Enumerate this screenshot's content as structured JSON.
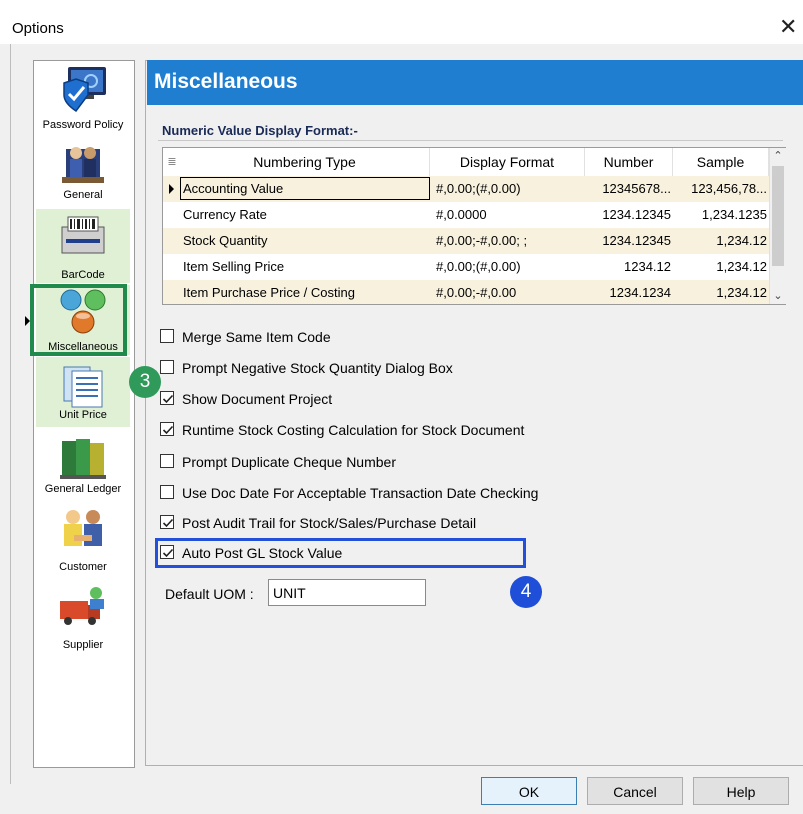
{
  "window": {
    "title": "Options",
    "close_glyph": "✕"
  },
  "sidebar": {
    "items": [
      {
        "label": "Password Policy",
        "icon": "monitor-shield-icon"
      },
      {
        "label": "General",
        "icon": "people-office-icon"
      },
      {
        "label": "BarCode",
        "icon": "barcode-printer-icon"
      },
      {
        "label": "Miscellaneous",
        "icon": "color-balls-icon"
      },
      {
        "label": "Unit Price",
        "icon": "price-sheets-icon"
      },
      {
        "label": "General Ledger",
        "icon": "ledger-books-icon"
      },
      {
        "label": "Customer",
        "icon": "customer-handshake-icon"
      },
      {
        "label": "Supplier",
        "icon": "supplier-truck-icon"
      }
    ],
    "selected": "Miscellaneous"
  },
  "badges": {
    "step3": "3",
    "step4": "4"
  },
  "panel": {
    "title": "Miscellaneous",
    "group_title": "Numeric Value Display Format:-",
    "grid": {
      "grip": "≣",
      "columns": [
        "Numbering Type",
        "Display Format",
        "Number",
        "Sample"
      ],
      "rows": [
        [
          "Accounting Value",
          "#,0.00;(#,0.00)",
          "12345678...",
          "123,456,78..."
        ],
        [
          "Currency Rate",
          "#,0.0000",
          "1234.12345",
          "1,234.1235"
        ],
        [
          "Stock Quantity",
          "#,0.00;-#,0.00; ;",
          "1234.12345",
          "1,234.12"
        ],
        [
          "Item Selling Price",
          "#,0.00;(#,0.00)",
          "1234.12",
          "1,234.12"
        ],
        [
          "Item Purchase Price / Costing",
          "#,0.00;-#,0.00",
          "1234.1234",
          "1,234.12"
        ]
      ],
      "scroll_up": "⌃",
      "scroll_down": "⌄"
    },
    "options": [
      {
        "label": "Merge Same Item Code",
        "checked": false
      },
      {
        "label": "Prompt Negative Stock Quantity Dialog Box",
        "checked": false
      },
      {
        "label": "Show Document Project",
        "checked": true
      },
      {
        "label": "Runtime Stock Costing Calculation for Stock Document",
        "checked": true
      },
      {
        "label": "Prompt Duplicate Cheque Number",
        "checked": false
      },
      {
        "label": "Use Doc Date For Acceptable Transaction Date Checking",
        "checked": false
      },
      {
        "label": "Post Audit Trail for Stock/Sales/Purchase Detail",
        "checked": true
      },
      {
        "label": "Auto Post GL Stock Value",
        "checked": true
      }
    ],
    "default_uom": {
      "label": "Default UOM :",
      "value": "UNIT"
    }
  },
  "buttons": {
    "ok": "OK",
    "cancel": "Cancel",
    "help": "Help"
  },
  "colors": {
    "header": "#1f7ed0",
    "selection_frame": "#1f8a4c",
    "highlight_box": "#2250d8",
    "badge_green": "#2f9a5a",
    "badge_blue": "#1f4fd8"
  }
}
